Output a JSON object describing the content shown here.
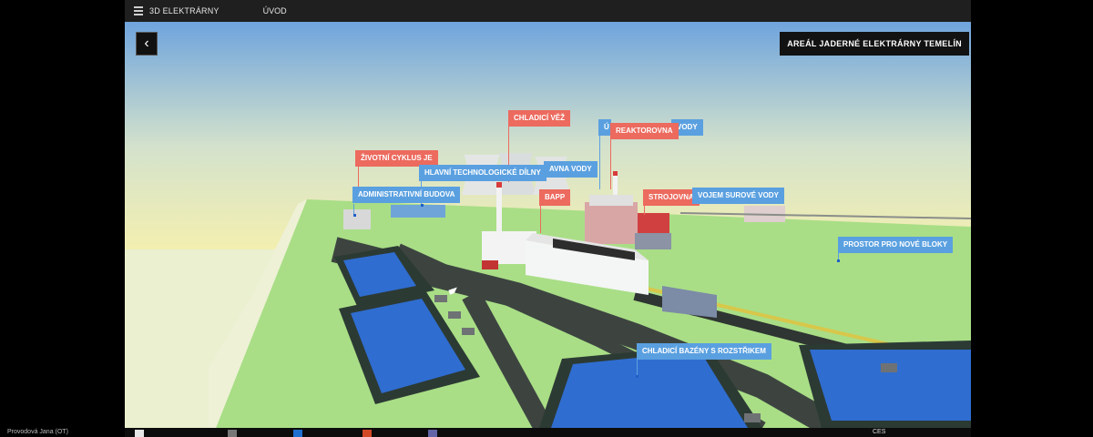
{
  "titlebar": {
    "app_name": "3D ELEKTRÁRNY",
    "nav_item": "ÚVOD"
  },
  "header": {
    "area_title": "AREÁL JADERNÉ ELEKTRÁRNY TEMELÍN",
    "back_icon": "chevron-left-icon"
  },
  "labels": {
    "chladici_vez": "CHLADICÍ VĚŽ",
    "zivotni_cyklus": "ŽIVOTNÍ CYKLUS JE",
    "hlavni_dilny": "HLAVNÍ TECHNOLOGICKÉ DÍLNY",
    "upravna_vody_partial": "AVNA VODY",
    "administrativni_budova": "ADMINISTRATIVNÍ BUDOVA",
    "bapp": "BAPP",
    "reaktorovna": "REAKTOROVNA",
    "u_vody_left": "Ú",
    "u_vody_right": "VODY",
    "strojovna": "STROJOVNA",
    "vojem_surove_vody": "VOJEM SUROVÉ VODY",
    "prostor_pro_nove_bloky": "PROSTOR PRO NOVÉ BLOKY",
    "chladici_bazeny": "CHLADICÍ BAZÉNY S ROZSTŘIKEM"
  },
  "colors": {
    "blue_label": "#5aa0e0",
    "red_label": "#ec6a5e",
    "grass": "#a8dd82",
    "road": "#3f4542",
    "water": "#2d6fd2"
  },
  "taskbar": {
    "user": "Provodová Jana (OT)",
    "lang": "CES"
  }
}
